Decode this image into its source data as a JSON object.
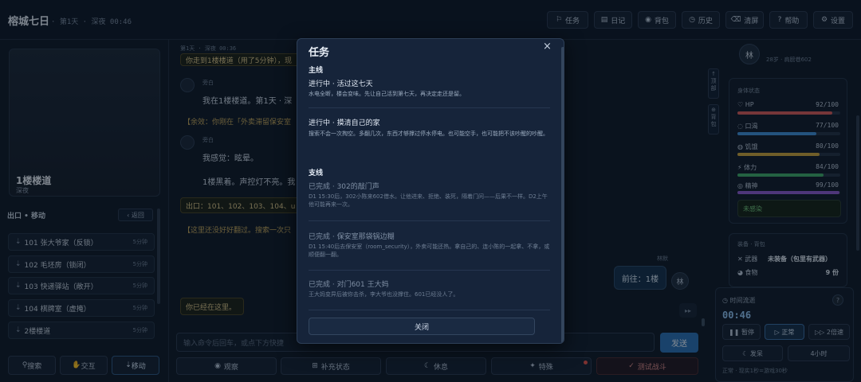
{
  "app": {
    "title": "榕城七日",
    "subtitle": "· 第1天 · 深夜 00:46"
  },
  "topnav": [
    {
      "icon": "task-icon",
      "glyph": "⚐",
      "label": "任务"
    },
    {
      "icon": "diary-icon",
      "glyph": "▤",
      "label": "日记"
    },
    {
      "icon": "bag-icon",
      "glyph": "◉",
      "label": "背包"
    },
    {
      "icon": "history-icon",
      "glyph": "◷",
      "label": "历史"
    },
    {
      "icon": "clear-icon",
      "glyph": "⌫",
      "label": "清屏"
    },
    {
      "icon": "help-icon",
      "glyph": "?",
      "label": "帮助"
    },
    {
      "icon": "gear-icon",
      "glyph": "⚙",
      "label": "设置"
    }
  ],
  "scene": {
    "name": "1楼楼道",
    "time": "深夜"
  },
  "exits": {
    "title": "出口 • 移动",
    "back": "‹ 返回",
    "items": [
      {
        "label": "101 张大爷家（反锁）",
        "time": "5分钟"
      },
      {
        "label": "102 毛坯房（锁闭）",
        "time": "5分钟"
      },
      {
        "label": "103 快递驿站（敞开）",
        "time": "5分钟"
      },
      {
        "label": "104 棋牌室（虚掩）",
        "time": "5分钟"
      },
      {
        "label": "2楼楼道",
        "time": "5分钟"
      }
    ]
  },
  "left_actions": [
    {
      "icon": "search-icon",
      "glyph": "⚲",
      "label": "搜索"
    },
    {
      "icon": "hand-icon",
      "glyph": "✋",
      "label": "交互"
    },
    {
      "icon": "move-icon",
      "glyph": "⇣",
      "label": "移动"
    }
  ],
  "feed": {
    "header": "第1天 · 深夜 00:36",
    "top_notice": "你走到1楼楼道（用了5分钟），现",
    "sender1": "旁白",
    "msg1": "我在1楼楼道。第1天 · 深",
    "remaining": "【余效：你刚在「外卖滞留保安室",
    "sender2": "旁白",
    "msg2": "我感觉：眩晕。",
    "msg3": "1楼黑着。声控灯不亮。我",
    "exits_line": "出口：101、102、103、104、u",
    "hint": "【这里还没好好翻过。搜索一次只",
    "player_name": "林默",
    "player_msg": "前往：1楼",
    "player_avatar": "林",
    "status": "你已经在这里。"
  },
  "input": {
    "placeholder": "输入命令后回车，或点下方快捷",
    "send": "发送"
  },
  "center_actions": [
    {
      "icon": "eye-icon",
      "glyph": "◉",
      "label": "观察"
    },
    {
      "icon": "status-icon",
      "glyph": "⊞",
      "label": "补充状态"
    },
    {
      "icon": "moon-icon",
      "glyph": "☾",
      "label": "休息"
    },
    {
      "icon": "star-icon",
      "glyph": "✦",
      "label": "特殊"
    },
    {
      "icon": "test-icon",
      "glyph": "✓",
      "label": "测试战斗"
    }
  ],
  "side_strip": [
    {
      "glyph": "↑",
      "label": "顶部"
    },
    {
      "glyph": "⊕",
      "label": "背包"
    }
  ],
  "character": {
    "avatar": "林",
    "name": "林默",
    "info": "28岁 · 肩膀巷602"
  },
  "stats": {
    "title": "身体状态",
    "items": [
      {
        "icon": "heart-icon",
        "glyph": "♡",
        "label": "HP",
        "value": "92/100",
        "fraction": 0.92,
        "color": "#d35a5a"
      },
      {
        "icon": "thirst-icon",
        "glyph": "◌",
        "label": "口渴",
        "value": "77/100",
        "fraction": 0.77,
        "color": "#3f8fd8"
      },
      {
        "icon": "hunger-icon",
        "glyph": "◍",
        "label": "饥饿",
        "value": "80/100",
        "fraction": 0.8,
        "color": "#c9a23c"
      },
      {
        "icon": "stamina-icon",
        "glyph": "⚡",
        "label": "体力",
        "value": "84/100",
        "fraction": 0.84,
        "color": "#3fa96a"
      },
      {
        "icon": "mind-icon",
        "glyph": "◎",
        "label": "精神",
        "value": "99/100",
        "fraction": 0.99,
        "color": "#8a5ad0"
      }
    ],
    "infection": "未感染"
  },
  "equipment": {
    "title": "装备 · 背包",
    "weapon_label": "武器",
    "weapon_value": "未装备（包里有武器）",
    "food_label": "食物",
    "food_value": "9 份"
  },
  "time_panel": {
    "title": "时间流逝",
    "clock": "00:46",
    "pause": "暂停",
    "normal": "正常",
    "double": "2倍速",
    "sleep": "发呆",
    "hours": "4小时",
    "footer": "正常 · 现实1秒=游戏30秒"
  },
  "modal": {
    "title": "任务",
    "main_label": "主线",
    "side_label": "支线",
    "main_quests": [
      {
        "title": "进行中 · 活过这七天",
        "desc": "水电全断，楼会变味。先让自己活到第七天，再决定走还是留。"
      },
      {
        "title": "进行中 · 摸清自己的家",
        "desc": "搜索不会一次掏空。多翻几次，东西才够撑过停水停电。也可能空手，也可能把不该吵醒的吵醒。"
      }
    ],
    "side_quests": [
      {
        "title": "已完成 · 302的敲门声",
        "desc": "D1 15:30后，302小陈来602借水。让他进来、拒绝、装死，隔着门问——后果不一样。D2上午他可能再来一次。"
      },
      {
        "title": "已完成 · 保安室那袋锅边糊",
        "desc": "D1 15:40后去保安室（room_security），外卖可能还热。拿自己的、连小陈的一起拿、不拿，或顺便翻一翻。"
      },
      {
        "title": "已完成 · 对门601 王大妈",
        "desc": "王大妈变异后被你击杀，李大爷也没撑住。601已经没人了。"
      }
    ],
    "close_button": "关闭",
    "close_icon": "×"
  }
}
